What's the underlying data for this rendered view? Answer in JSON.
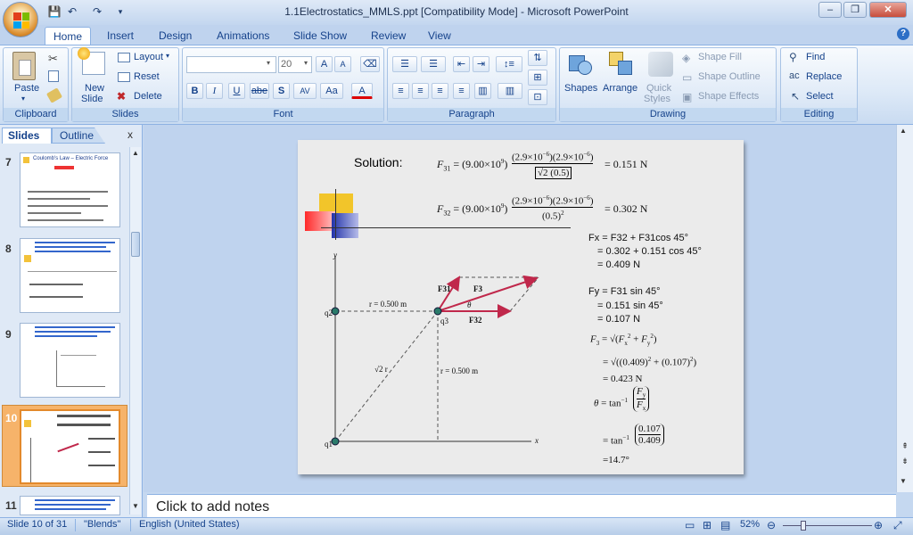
{
  "window": {
    "title": "1.1Electrostatics_MMLS.ppt [Compatibility Mode] - Microsoft PowerPoint",
    "min": "–",
    "restore": "❐",
    "close": "✕"
  },
  "tabs": [
    "Home",
    "Insert",
    "Design",
    "Animations",
    "Slide Show",
    "Review",
    "View"
  ],
  "ribbon": {
    "clipboard": {
      "label": "Clipboard",
      "paste": "Paste"
    },
    "slides": {
      "label": "Slides",
      "new_slide_1": "New",
      "new_slide_2": "Slide",
      "layout": "Layout",
      "reset": "Reset",
      "delete": "Delete"
    },
    "font": {
      "label": "Font",
      "size": "20",
      "bold": "B",
      "italic": "I",
      "underline": "U",
      "strike": "abe",
      "shadow": "S",
      "spacing": "AV",
      "case": "Aa",
      "color": "A",
      "grow": "A",
      "shrink": "A"
    },
    "paragraph": {
      "label": "Paragraph"
    },
    "drawing": {
      "label": "Drawing",
      "shapes": "Shapes",
      "arrange": "Arrange",
      "quick_styles_1": "Quick",
      "quick_styles_2": "Styles",
      "shape_fill": "Shape Fill",
      "shape_outline": "Shape Outline",
      "shape_effects": "Shape Effects"
    },
    "editing": {
      "label": "Editing",
      "find": "Find",
      "replace": "Replace",
      "select": "Select"
    }
  },
  "pane": {
    "slides_tab": "Slides",
    "outline_tab": "Outline",
    "close": "x"
  },
  "thumbs": [
    {
      "num": "7",
      "title": "Coulomb's Law – Electric Force"
    },
    {
      "num": "8",
      "title": ""
    },
    {
      "num": "9",
      "title": ""
    },
    {
      "num": "10",
      "title": ""
    },
    {
      "num": "11",
      "title": ""
    }
  ],
  "slide": {
    "solution": "Solution:",
    "f31_result": "= 0.151 N",
    "f32_result": "= 0.302 N",
    "fx_1": "Fx = F32 + F31cos 45°",
    "fx_2": "= 0.302 + 0.151 cos 45°",
    "fx_3": "= 0.409 N",
    "fy_1": "Fy = F31 sin 45°",
    "fy_2": "= 0.151 sin 45°",
    "fy_3": "= 0.107 N",
    "f3_result": "= 0.423 N",
    "theta_result": "=14.7°",
    "diagram": {
      "y_axis": "y",
      "x_axis": "x",
      "q1": "q1",
      "q2": "q2",
      "q3": "q3",
      "r_top": "r = 0.500 m",
      "r_right": "r = 0.500 m",
      "r_diag": "√2 r",
      "f31": "F31",
      "f3": "F3",
      "f32": "F32",
      "theta": "θ"
    }
  },
  "notes": "Click to add notes",
  "status": {
    "slide": "Slide 10 of 31",
    "theme": "\"Blends\"",
    "language": "English (United States)",
    "zoom": "52%"
  }
}
